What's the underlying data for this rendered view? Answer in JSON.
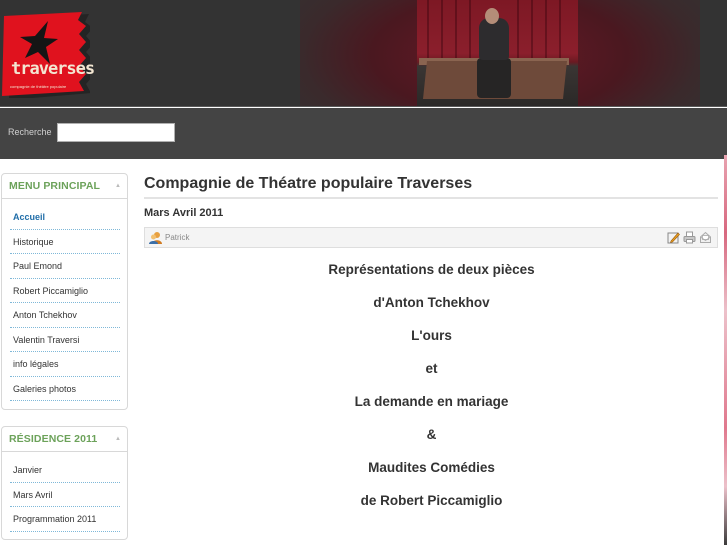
{
  "header": {
    "logo": {
      "text": "traverses",
      "subtitle": "compagnie de théâtre populaire",
      "brand_color": "#e0121e"
    },
    "banner_image": "stage-photo-actor-seated-on-crate"
  },
  "search": {
    "label": "Recherche",
    "value": "",
    "placeholder": ""
  },
  "sidebar": {
    "menu_principal": {
      "title": "MENU PRINCIPAL",
      "items": [
        {
          "label": "Accueil",
          "active": true
        },
        {
          "label": "Historique"
        },
        {
          "label": "Paul Emond"
        },
        {
          "label": "Robert Piccamiglio"
        },
        {
          "label": "Anton Tchekhov"
        },
        {
          "label": "Valentin Traversi"
        },
        {
          "label": "info légales"
        },
        {
          "label": "Galeries photos"
        }
      ]
    },
    "residence": {
      "title": "RÉSIDENCE 2011",
      "items": [
        {
          "label": "Janvier"
        },
        {
          "label": "Mars Avril"
        },
        {
          "label": "Programmation 2011"
        }
      ]
    }
  },
  "main": {
    "page_title": "Compagnie de Théatre populaire Traverses",
    "article_title": "Mars Avril 2011",
    "author": "Patrick",
    "tools": [
      "edit-icon",
      "print-icon",
      "email-icon"
    ],
    "body_lines": [
      "Représentations de deux pièces",
      "d'Anton Tchekhov",
      "L'ours",
      "et",
      "La demande en mariage",
      "&",
      "Maudites Comédies",
      "de Robert Piccamiglio"
    ]
  },
  "colors": {
    "header_bg": "#333333",
    "searchbar_bg": "#444444",
    "module_title": "#6ca25a",
    "active_link": "#1f6da8",
    "separator": "#7fb8d8"
  }
}
